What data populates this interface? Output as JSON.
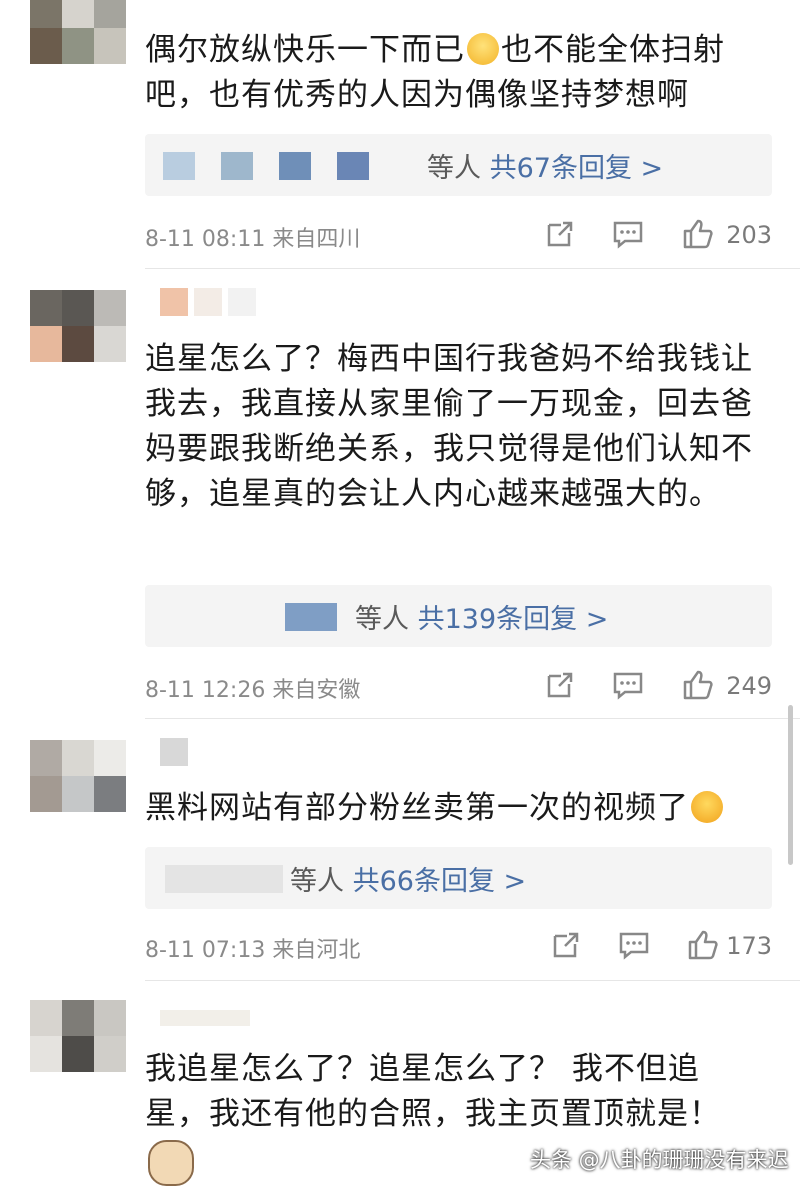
{
  "comments": [
    {
      "text_lines": [
        "偶尔放纵快乐一下而已",
        "也不能全体扫射",
        "吧，也有优秀的人因为偶像坚持梦想啊"
      ],
      "reply_suffix": "等人",
      "reply_count": "共67条回复 >",
      "time": "8-11 08:11",
      "location": "来自四川",
      "likes": "203"
    },
    {
      "text": "追星怎么了？梅西中国行我爸妈不给我钱让我去，我直接从家里偷了一万现金，回去爸妈要跟我断绝关系，我只觉得是他们认知不够，追星真的会让人内心越来越强大的。",
      "reply_suffix": "等人",
      "reply_count": "共139条回复 >",
      "time": "8-11 12:26",
      "location": "来自安徽",
      "likes": "249"
    },
    {
      "text": "黑料网站有部分粉丝卖第一次的视频了",
      "reply_suffix": "等人",
      "reply_count": "共66条回复 >",
      "time": "8-11 07:13",
      "location": "来自河北",
      "likes": "173"
    },
    {
      "text": "我追星怎么了？追星怎么了？ 我不但追星，我还有他的合照，我主页置顶就是！"
    }
  ],
  "watermark": "头条 @八卦的珊珊没有来迟",
  "icons": [
    "share-icon",
    "comment-icon",
    "like-icon",
    "smile-emoji-icon",
    "shock-emoji-icon",
    "cat-emoji-icon"
  ],
  "colors": {
    "reply_count": "#4a6fa5",
    "meta": "#8a8a8a",
    "reply_bg": "#f4f4f4"
  }
}
